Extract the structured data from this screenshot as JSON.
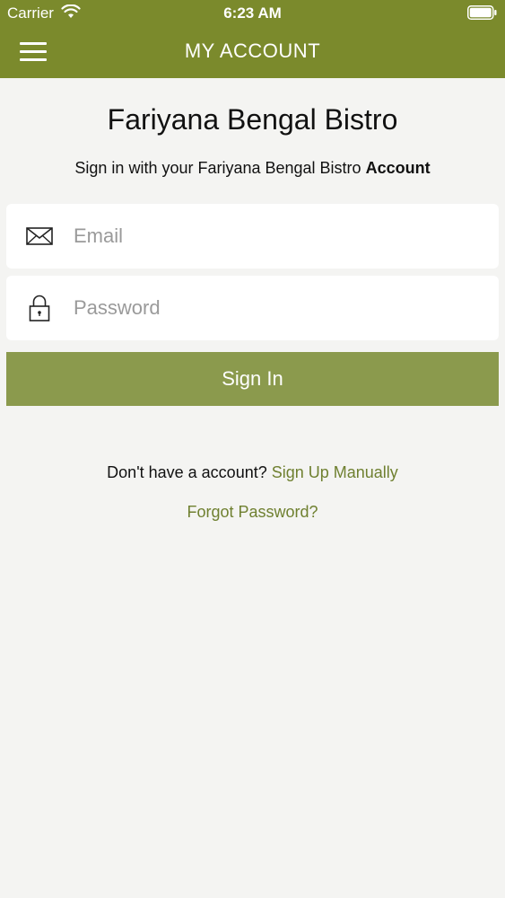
{
  "status_bar": {
    "carrier": "Carrier",
    "time": "6:23 AM",
    "wifi_icon": "wifi-icon",
    "battery_icon": "battery-icon"
  },
  "nav": {
    "title": "MY ACCOUNT",
    "menu_icon": "hamburger-menu-icon"
  },
  "main": {
    "heading": "Fariyana Bengal Bistro",
    "subheading_prefix": "Sign in with your Fariyana Bengal Bistro ",
    "subheading_bold": "Account",
    "email": {
      "icon": "envelope-icon",
      "placeholder": "Email",
      "value": ""
    },
    "password": {
      "icon": "lock-icon",
      "placeholder": "Password",
      "value": ""
    },
    "signin_label": "Sign In",
    "no_account_text": "Don't have a account? ",
    "signup_link": "Sign Up Manually",
    "forgot_link": "Forgot Password?"
  },
  "colors": {
    "header": "#7b8a2c",
    "button": "#8b9a4d",
    "link": "#6f8030",
    "background": "#f4f4f2"
  }
}
